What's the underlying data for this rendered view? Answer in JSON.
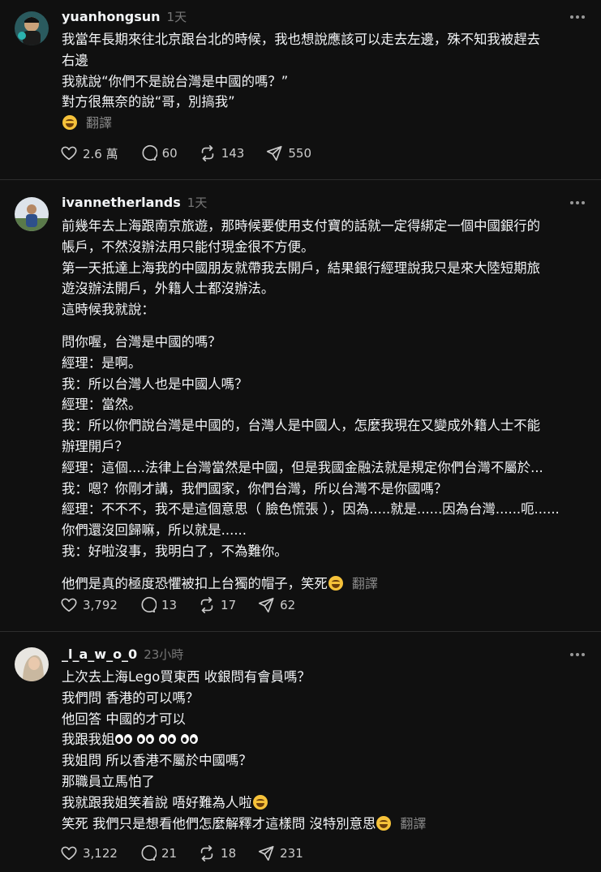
{
  "posts": [
    {
      "username": "yuanhongsun",
      "time": "1天",
      "lines": [
        "我當年長期來往北京跟台北的時候，我也想說應該可以走去左邊，殊不知我被趕去",
        "右邊",
        "我就說“你們不是說台灣是中國的嗎？”",
        "對方很無奈的說“哥，別搞我”"
      ],
      "emoji_name": "rolling-on-floor-laughing",
      "translate": "翻譯",
      "likes": "2.6 萬",
      "comments": "60",
      "reposts": "143",
      "shares": "550"
    },
    {
      "username": "ivannetherlands",
      "time": "1天",
      "lines": [
        "前幾年去上海跟南京旅遊，那時候要使用支付寶的話就一定得綁定一個中國銀行的",
        "帳戶，不然沒辦法用只能付現金很不方便。",
        "第一天抵達上海我的中國朋友就帶我去開戶，結果銀行經理說我只是來大陸短期旅",
        "遊沒辦法開戶，外籍人士都沒辦法。",
        "這時候我就說："
      ],
      "dialog": [
        "問你喔，台灣是中國的嗎？",
        "經理：是啊。",
        "我：所以台灣人也是中國人嗎？",
        "經理：當然。",
        "我：所以你們說台灣是中國的，台灣人是中國人，怎麼我現在又變成外籍人士不能",
        "辦理開戶？",
        "經理：這個....法律上台灣當然是中國，但是我國金融法就是規定你們台灣不屬於...",
        "我：嗯？你剛才講，我們國家，你們台灣，所以台灣不是你國嗎？",
        "經理：不不不，我不是這個意思（ 臉色慌張 ），因為.....就是......因為台灣......呃......",
        "你們還沒回歸嘛，所以就是......",
        "我：好啦沒事，我明白了，不為難你。"
      ],
      "last_line": "他們是真的極度恐懼被扣上台獨的帽子，笑死",
      "translate": "翻譯",
      "likes": "3,792",
      "comments": "13",
      "reposts": "17",
      "shares": "62"
    },
    {
      "username": "_l_a_w_o_0",
      "time": "23小時",
      "lines": [
        "上次去上海Lego買東西 收銀問有會員嗎？",
        "我們問 香港的可以嗎？",
        "他回答 中國的才可以"
      ],
      "eyes_line": "我跟我姐",
      "lines2": [
        "我姐問 所以香港不屬於中國嗎？",
        "那職員立馬怕了"
      ],
      "laugh_line1": "我就跟我姐笑着說 唔好難為人啦",
      "laugh_line2": "笑死 我們只是想看他們怎麼解釋才這樣問 沒特別意思",
      "translate": "翻譯",
      "likes": "3,122",
      "comments": "21",
      "reposts": "18",
      "shares": "231"
    }
  ]
}
